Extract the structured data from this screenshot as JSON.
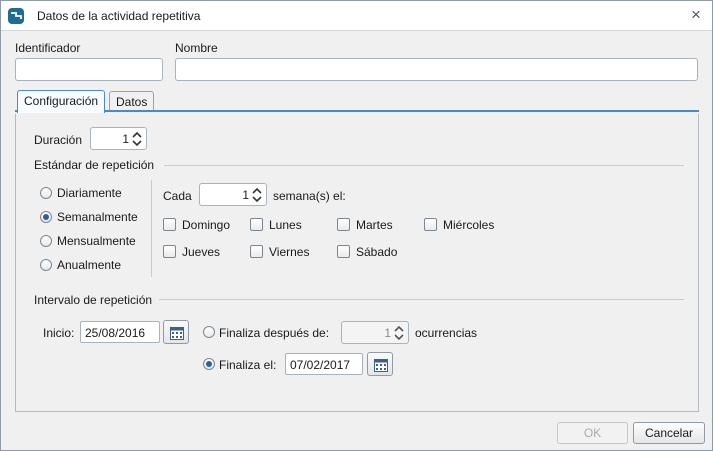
{
  "window": {
    "title": "Datos de la actividad repetitiva",
    "app_icon": "app-logo-icon",
    "close_glyph": "×"
  },
  "header": {
    "identificador_label": "Identificador",
    "identificador_value": "",
    "nombre_label": "Nombre",
    "nombre_value": ""
  },
  "tabs": [
    {
      "label": "Configuración",
      "active": true
    },
    {
      "label": "Datos",
      "active": false
    }
  ],
  "duracion": {
    "label": "Duración",
    "value": "1"
  },
  "estandar": {
    "section_label": "Estándar de repetición",
    "options": [
      {
        "label": "Diariamente",
        "checked": false
      },
      {
        "label": "Semanalmente",
        "checked": true
      },
      {
        "label": "Mensualmente",
        "checked": false
      },
      {
        "label": "Anualmente",
        "checked": false
      }
    ],
    "cada_label": "Cada",
    "cada_value": "1",
    "semanas_label": "semana(s) el:",
    "days": [
      {
        "label": "Domingo",
        "checked": false
      },
      {
        "label": "Lunes",
        "checked": false
      },
      {
        "label": "Martes",
        "checked": false
      },
      {
        "label": "Miércoles",
        "checked": false
      },
      {
        "label": "Jueves",
        "checked": false
      },
      {
        "label": "Viernes",
        "checked": false
      },
      {
        "label": "Sábado",
        "checked": false
      }
    ]
  },
  "intervalo": {
    "section_label": "Intervalo de repetición",
    "inicio_label": "Inicio:",
    "inicio_value": "25/08/2016",
    "finaliza_despues_label": "Finaliza después de:",
    "finaliza_despues_checked": false,
    "ocurrencias_value": "1",
    "ocurrencias_label": "ocurrencias",
    "finaliza_el_label": "Finaliza el:",
    "finaliza_el_checked": true,
    "finaliza_el_value": "07/02/2017"
  },
  "footer": {
    "ok_label": "OK",
    "ok_disabled": true,
    "cancel_label": "Cancelar"
  },
  "colors": {
    "accent": "#4a8ac9",
    "app_icon_bg": "#1f6e8f",
    "radio_dot": "#2b5fa0"
  }
}
